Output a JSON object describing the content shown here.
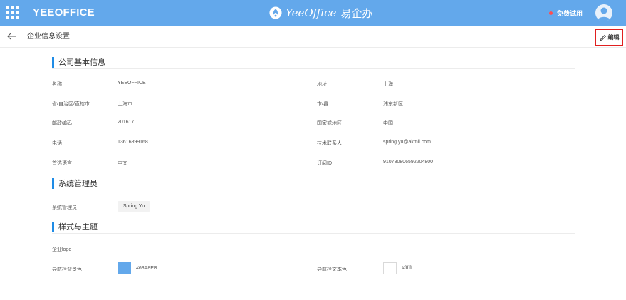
{
  "colors": {
    "accent": "#63A8EB",
    "section_bar": "#1f8ce6",
    "highlight_border": "#e02020",
    "trial_dot": "#ff4d4f"
  },
  "topbar": {
    "app_name": "YEEOFFICE",
    "brand_text": "YeeOffice",
    "brand_cn": "易企办",
    "trial_label": "免费试用",
    "icons": [
      "apps-grid-icon",
      "brand-logo-icon",
      "user-avatar-icon"
    ]
  },
  "subheader": {
    "title": "企业信息设置",
    "edit_label": "编辑",
    "icons": [
      "back-arrow-icon",
      "pencil-icon"
    ]
  },
  "company_info": {
    "title": "公司基本信息",
    "fields": {
      "name": {
        "label": "名称",
        "value": "YEEOFFICE"
      },
      "address": {
        "label": "地址",
        "value": "上海"
      },
      "province": {
        "label": "省/自治区/直辖市",
        "value": "上海市"
      },
      "city": {
        "label": "市/县",
        "value": "浦东新区"
      },
      "postcode": {
        "label": "邮政编码",
        "value": "201617"
      },
      "country": {
        "label": "国家或地区",
        "value": "中国"
      },
      "phone": {
        "label": "电话",
        "value": "13616899168"
      },
      "contact": {
        "label": "技术联系人",
        "value": "spring.yu@akmii.com"
      },
      "language": {
        "label": "首选语言",
        "value": "中文"
      },
      "sub_id": {
        "label": "订阅ID",
        "value": "910780806592204800"
      }
    }
  },
  "admins": {
    "title": "系统管理员",
    "label": "系统管理员",
    "admin_name": "Spring Yu"
  },
  "theme": {
    "title": "样式与主题",
    "logo_label": "企业logo",
    "nav_bg_label": "导航栏背景色",
    "nav_bg_value": "#63A8EB",
    "nav_text_label": "导航栏文本色",
    "nav_text_value": "#ffffff"
  }
}
